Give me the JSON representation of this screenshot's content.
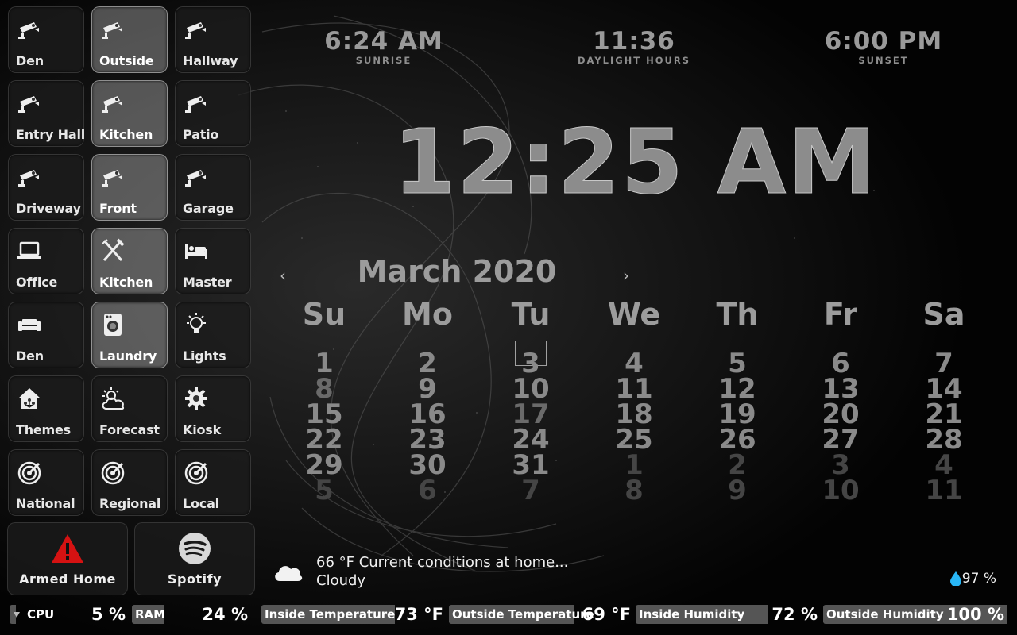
{
  "tiles": [
    {
      "label": "Den",
      "icon": "camera-icon"
    },
    {
      "label": "Outside",
      "icon": "camera-icon"
    },
    {
      "label": "Hallway",
      "icon": "camera-icon"
    },
    {
      "label": "Entry Hall",
      "icon": "camera-icon"
    },
    {
      "label": "Kitchen",
      "icon": "camera-icon"
    },
    {
      "label": "Patio",
      "icon": "camera-icon"
    },
    {
      "label": "Driveway",
      "icon": "camera-icon"
    },
    {
      "label": "Front",
      "icon": "camera-icon"
    },
    {
      "label": "Garage",
      "icon": "camera-icon"
    },
    {
      "label": "Office",
      "icon": "laptop-icon"
    },
    {
      "label": "Kitchen",
      "icon": "utensils-icon"
    },
    {
      "label": "Master",
      "icon": "bed-icon"
    },
    {
      "label": "Den",
      "icon": "sofa-icon"
    },
    {
      "label": "Laundry",
      "icon": "washer-icon"
    },
    {
      "label": "Lights",
      "icon": "lightbulb-icon"
    },
    {
      "label": "Themes",
      "icon": "home-theme-icon"
    },
    {
      "label": "Forecast",
      "icon": "partly-cloudy-icon"
    },
    {
      "label": "Kiosk",
      "icon": "gear-icon"
    },
    {
      "label": "National",
      "icon": "radar-icon"
    },
    {
      "label": "Regional",
      "icon": "radar-icon"
    },
    {
      "label": "Local",
      "icon": "radar-icon"
    }
  ],
  "alarm": {
    "label": "Armed Home",
    "icon": "alert-triangle-icon"
  },
  "spotify": {
    "label": "Spotify",
    "icon": "spotify-icon"
  },
  "sun": {
    "sunrise_time": "6:24 AM",
    "sunrise_label": "SUNRISE",
    "daylight_time": "11:36",
    "daylight_label": "DAYLIGHT HOURS",
    "sunset_time": "6:00 PM",
    "sunset_label": "SUNSET"
  },
  "clock": "12:25 AM",
  "calendar": {
    "month_label": "March 2020",
    "prev": "‹",
    "next": "›",
    "weekdays": [
      "Su",
      "Mo",
      "Tu",
      "We",
      "Th",
      "Fr",
      "Sa"
    ],
    "today": 3,
    "weeks": [
      [
        "1",
        "2",
        "3",
        "4",
        "5",
        "6",
        "7"
      ],
      [
        "8",
        "9",
        "10",
        "11",
        "12",
        "13",
        "14"
      ],
      [
        "15",
        "16",
        "17",
        "18",
        "19",
        "20",
        "21"
      ],
      [
        "22",
        "23",
        "24",
        "25",
        "26",
        "27",
        "28"
      ],
      [
        "29",
        "30",
        "31",
        "1",
        "2",
        "3",
        "4"
      ],
      [
        "5",
        "6",
        "7",
        "8",
        "9",
        "10",
        "11"
      ]
    ]
  },
  "weather": {
    "line1": "66 °F Current conditions at home...",
    "line2": "Cloudy",
    "humidity": "97 %",
    "icon": "cloud-icon"
  },
  "sensors": [
    {
      "name": "CPU",
      "value": "5 %",
      "level": 0.05
    },
    {
      "name": "RAM",
      "value": "24 %",
      "level": 0.24
    },
    {
      "name": "Inside Temperature",
      "value": "73 °F"
    },
    {
      "name": "Outside Temperature",
      "value": "69 °F"
    },
    {
      "name": "Inside Humidity",
      "value": "72 %"
    },
    {
      "name": "Outside Humidity",
      "value": "100 %"
    }
  ],
  "colors": {
    "background": "#050505",
    "text_dim": "#8c8c8c",
    "alarm_red": "#d51212",
    "drop_blue": "#29b6f6"
  }
}
